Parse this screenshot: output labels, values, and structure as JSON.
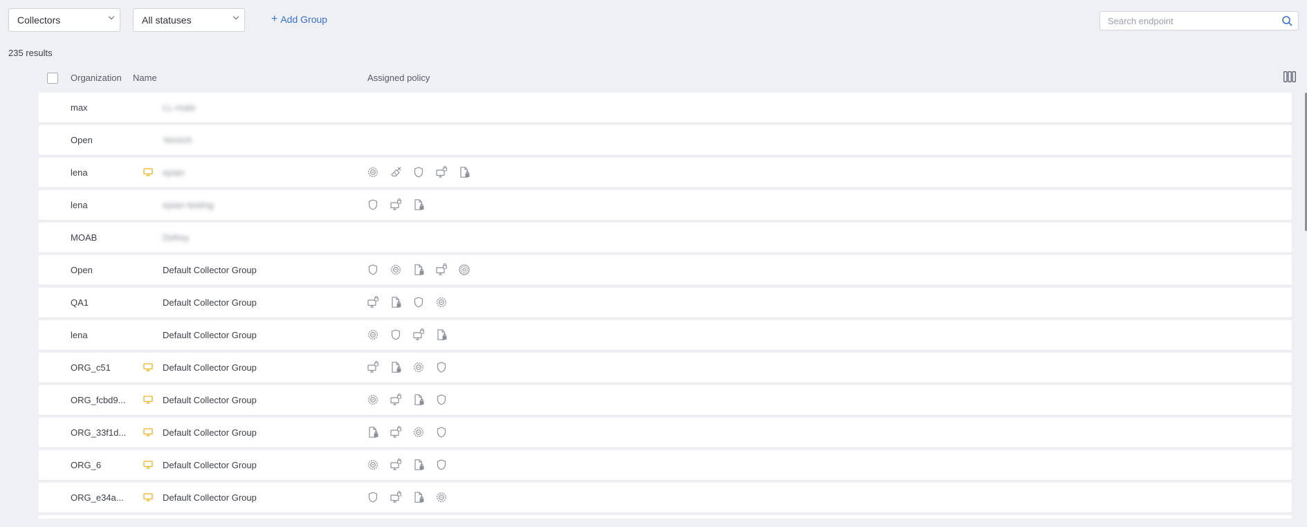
{
  "filters": {
    "group_dropdown": "Collectors",
    "status_dropdown": "All statuses",
    "add_group": "Add Group"
  },
  "search": {
    "placeholder": "Search endpoint"
  },
  "results_count": "235 results",
  "table": {
    "headers": {
      "organization": "Organization",
      "name": "Name",
      "policy": "Assigned policy"
    },
    "rows": [
      {
        "org": "max",
        "device": false,
        "name": "LL-mate",
        "blurred": true,
        "policies": []
      },
      {
        "org": "Open",
        "device": false,
        "name": "Yenrich",
        "blurred": true,
        "policies": []
      },
      {
        "org": "lena",
        "device": true,
        "name": "epian",
        "blurred": true,
        "policies": [
          "gear-policy-icon",
          "eraser-policy-icon",
          "shield-policy-icon",
          "monitor-lock-policy-icon",
          "file-lock-policy-icon"
        ]
      },
      {
        "org": "lena",
        "device": false,
        "name": "epian testing",
        "blurred": true,
        "policies": [
          "shield-policy-icon",
          "monitor-lock-policy-icon",
          "file-lock-policy-icon"
        ]
      },
      {
        "org": "MOAB",
        "device": false,
        "name": "Defrey",
        "blurred": true,
        "policies": []
      },
      {
        "org": "Open",
        "device": false,
        "name": "Default Collector Group",
        "blurred": false,
        "policies": [
          "shield-policy-icon",
          "gear-policy-icon",
          "file-lock-policy-icon",
          "monitor-lock-policy-icon",
          "target-policy-icon"
        ]
      },
      {
        "org": "QA1",
        "device": false,
        "name": "Default Collector Group",
        "blurred": false,
        "policies": [
          "monitor-lock-policy-icon",
          "file-lock-policy-icon",
          "shield-policy-icon",
          "gear-policy-icon"
        ]
      },
      {
        "org": "lena",
        "device": false,
        "name": "Default Collector Group",
        "blurred": false,
        "policies": [
          "gear-policy-icon",
          "shield-policy-icon",
          "monitor-lock-policy-icon",
          "file-lock-policy-icon"
        ]
      },
      {
        "org": "ORG_c51",
        "device": true,
        "name": "Default Collector Group",
        "blurred": false,
        "policies": [
          "monitor-lock-policy-icon",
          "file-lock-policy-icon",
          "gear-policy-icon",
          "shield-policy-icon"
        ]
      },
      {
        "org": "ORG_fcbd9...",
        "device": true,
        "name": "Default Collector Group",
        "blurred": false,
        "policies": [
          "gear-policy-icon",
          "monitor-lock-policy-icon",
          "file-lock-policy-icon",
          "shield-policy-icon"
        ]
      },
      {
        "org": "ORG_33f1d...",
        "device": true,
        "name": "Default Collector Group",
        "blurred": false,
        "policies": [
          "file-lock-policy-icon",
          "monitor-lock-policy-icon",
          "gear-policy-icon",
          "shield-policy-icon"
        ]
      },
      {
        "org": "ORG_6",
        "device": true,
        "name": "Default Collector Group",
        "blurred": false,
        "policies": [
          "gear-policy-icon",
          "monitor-lock-policy-icon",
          "file-lock-policy-icon",
          "shield-policy-icon"
        ]
      },
      {
        "org": "ORG_e34a...",
        "device": true,
        "name": "Default Collector Group",
        "blurred": false,
        "policies": [
          "shield-policy-icon",
          "monitor-lock-policy-icon",
          "file-lock-policy-icon",
          "gear-policy-icon"
        ]
      },
      {
        "org": "",
        "device": false,
        "name": "",
        "blurred": false,
        "policies": []
      }
    ]
  },
  "colors": {
    "accent": "#3b6fd6",
    "device_icon": "#f2b01e",
    "policy_icon": "#8a8f99"
  }
}
